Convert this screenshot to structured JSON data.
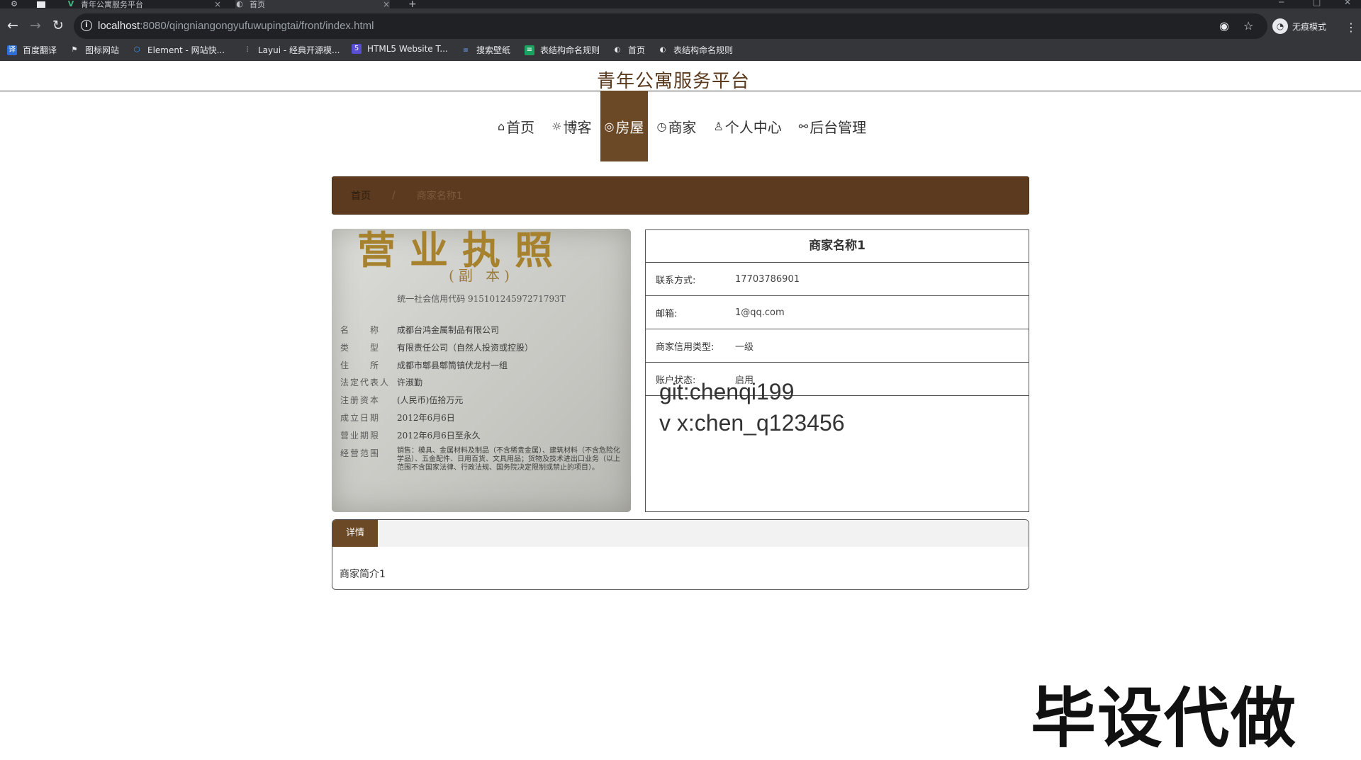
{
  "browser": {
    "tabs": [
      {
        "title": "",
        "icon": "app-icon"
      },
      {
        "title": "",
        "icon": "page-icon"
      },
      {
        "title": "青年公寓服务平台",
        "icon": "vue-icon"
      },
      {
        "title": "首页",
        "icon": "globe-icon"
      }
    ],
    "url_host": "localhost",
    "url_rest": ":8080/qingniangongyufuwupingtai/front/index.html",
    "incognito_label": "无痕模式",
    "bookmarks": [
      "百度翻译",
      "图标网站",
      "Element - 网站快...",
      "Layui - 经典开源模...",
      "HTML5 Website T...",
      "搜索壁纸",
      "表结构命名规则",
      "首页",
      "表结构命名规则"
    ]
  },
  "site": {
    "title": "青年公寓服务平台"
  },
  "nav": [
    {
      "label": "首页",
      "icon": "⌂"
    },
    {
      "label": "博客",
      "icon": "☼"
    },
    {
      "label": "房屋",
      "icon": "◎"
    },
    {
      "label": "商家",
      "icon": "◷"
    },
    {
      "label": "个人中心",
      "icon": "♙"
    },
    {
      "label": "后台管理",
      "icon": "⚯"
    }
  ],
  "breadcrumb": {
    "home": "首页",
    "separator": "/",
    "current": "商家名称1"
  },
  "license": {
    "title": "营业执照",
    "subtitle": "(副 本)",
    "credit_code": "统一社会信用代码 91510124597271793T",
    "rows": [
      {
        "k": "名　　称",
        "v": "成都台鸿金属制品有限公司"
      },
      {
        "k": "类　　型",
        "v": "有限责任公司（自然人投资或控股）"
      },
      {
        "k": "住　　所",
        "v": "成都市郫县郫筒镇伏龙村一组"
      },
      {
        "k": "法定代表人",
        "v": "许淑勤"
      },
      {
        "k": "注册资本",
        "v": "(人民币)伍拾万元"
      },
      {
        "k": "成立日期",
        "v": "2012年6月6日"
      },
      {
        "k": "营业期限",
        "v": "2012年6月6日至永久"
      }
    ],
    "scope_label": "经营范围",
    "scope_text": "销售：模具、金属材料及制品（不含稀贵金属）、建筑材料（不含危险化学品）、五金配件、日用百货、文具用品；货物及技术进出口业务（以上范围不含国家法律、行政法规、国务院决定限制或禁止的项目）。"
  },
  "merchant": {
    "name": "商家名称1",
    "fields": [
      {
        "label": "联系方式:",
        "value": "17703786901"
      },
      {
        "label": "邮箱:",
        "value": "1@qq.com"
      },
      {
        "label": "商家信用类型:",
        "value": "一级"
      },
      {
        "label": "账户状态:",
        "value": "启用"
      }
    ]
  },
  "overlay": {
    "line1": "git:chenqi199",
    "line2": "v x:chen_q123456"
  },
  "detail": {
    "tab_label": "详情",
    "content": "商家简介1"
  },
  "watermark": "毕设代做",
  "colors": {
    "accent": "#6b4826",
    "breadcrumb_bg": "#5b3a1f",
    "chrome_dark": "#202124",
    "chrome": "#35363a"
  }
}
